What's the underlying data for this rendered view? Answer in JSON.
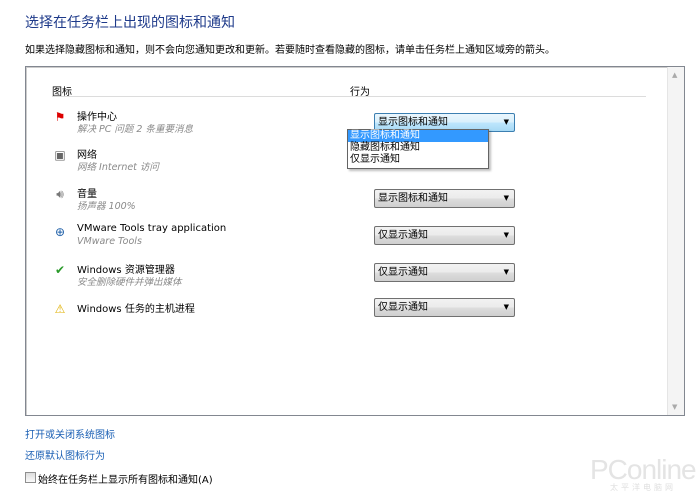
{
  "title": "选择在任务栏上出现的图标和通知",
  "description": "如果选择隐藏图标和通知，则不会向您通知更改和更新。若要随时查看隐藏的图标，请单击任务栏上通知区域旁的箭头。",
  "table": {
    "col_icon": "图标",
    "col_behavior": "行为"
  },
  "rows": [
    {
      "name": "操作中心",
      "sub": "解决 PC 问题  2 条重要消息",
      "behavior": "显示图标和通知",
      "icon": "action-center-flag-icon"
    },
    {
      "name": "网络",
      "sub": "网络 Internet 访问",
      "behavior": "",
      "icon": "network-icon"
    },
    {
      "name": "音量",
      "sub": "扬声器 100%",
      "behavior": "显示图标和通知",
      "icon": "speaker-icon"
    },
    {
      "name": "VMware Tools tray application",
      "sub": "VMware Tools",
      "behavior": "仅显示通知",
      "icon": "vmware-icon"
    },
    {
      "name": "Windows 资源管理器",
      "sub": "安全删除硬件并弹出媒体",
      "behavior": "仅显示通知",
      "icon": "safely-remove-hardware-icon"
    },
    {
      "name": "Windows 任务的主机进程",
      "sub": "",
      "behavior": "仅显示通知",
      "icon": "warning-icon"
    }
  ],
  "dropdown_options": [
    "显示图标和通知",
    "隐藏图标和通知",
    "仅显示通知"
  ],
  "links": {
    "system_icons": "打开或关闭系统图标",
    "restore": "还原默认图标行为"
  },
  "checkbox": {
    "label": "始终在任务栏上显示所有图标和通知(A)",
    "checked": false
  },
  "watermark": {
    "brand": "PConline",
    "sub": "太平洋电脑网"
  }
}
